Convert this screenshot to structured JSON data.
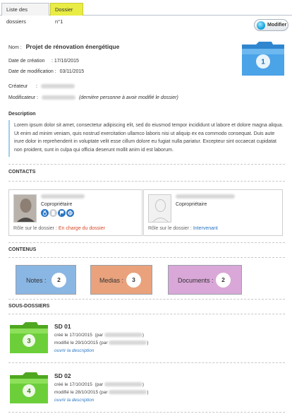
{
  "tabs": [
    {
      "label": "Liste des dossiers"
    },
    {
      "label": "Dossier n°1"
    }
  ],
  "toolbar": {
    "modify_label": "Modifier"
  },
  "dossier": {
    "nom_label": "Nom :",
    "nom": "Projet de rénovation énergétique",
    "creation_label": "Date de création",
    "creation_value": ":  17/10/2015",
    "modification_label": "Date de modification :",
    "modification_value": "03/11/2015",
    "createur_label": "Créateur",
    "createur_sep": ":",
    "modificateur_label": "Modificateur :",
    "modificateur_note": "(dernière personne à avoir modifié le dossier)",
    "folder_number": "1"
  },
  "description": {
    "title": "Description",
    "text": "Lorem ipsum dolor sit amet, consectetur adipiscing elit, sed do eiusmod tempor incididunt ut labore et dolore magna aliqua. Ut enim ad minim veniam, quis nostrud exercitation ullamco laboris nisi ut aliquip ex ea commodo consequat. Duis aute irure dolor in reprehenderit in voluptate velit esse cillum dolore eu fugiat nulla pariatur. Excepteur sint occaecat cupidatat non proident, sunt in culpa qui officia deserunt mollit anim id est laborum."
  },
  "contacts": {
    "title": "CONTACTS",
    "items": [
      {
        "role": "Copropriétaire",
        "dossier_role_label": "Rôle sur le dossier :",
        "dossier_role": "En charge du dossier",
        "role_color": "#d94a2a"
      },
      {
        "role": "Copropriétaire",
        "dossier_role_label": "Rôle sur le dossier :",
        "dossier_role": "Intervenant",
        "role_color": "#2a76c4"
      }
    ]
  },
  "contenus": {
    "title": "CONTENUS",
    "boxes": [
      {
        "label": "Notes :",
        "count": "2",
        "color": "#8ab6e3"
      },
      {
        "label": "Medias :",
        "count": "3",
        "color": "#e9a27c"
      },
      {
        "label": "Documents :",
        "count": "2",
        "color": "#d9a7d8"
      }
    ]
  },
  "sous_dossiers": {
    "title": "SOUS-DOSSIERS",
    "items": [
      {
        "title": "SD 01",
        "number": "3",
        "created": "créé le 17/10/2015",
        "par_open": "(par",
        "par_close": ")",
        "modified": "modifié le 29/10/2015",
        "link": "ouvrir la description"
      },
      {
        "title": "SD 02",
        "number": "4",
        "created": "créé le 17/10/2015",
        "par_open": "(par",
        "par_close": ")",
        "modified": "modifié le 28/10/2015",
        "link": "ouvrir la description"
      }
    ]
  },
  "colors": {
    "accent_tab": "#e9ec44",
    "folder_blue": "#3d97df",
    "folder_green": "#6ccf3a",
    "link_blue": "#2a76c4"
  }
}
